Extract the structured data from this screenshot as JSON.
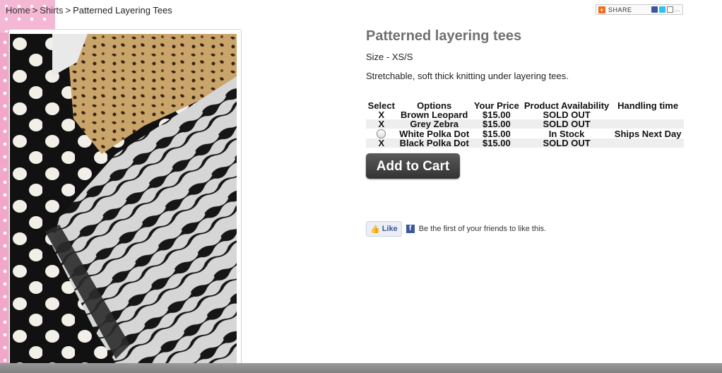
{
  "breadcrumb": {
    "home": "Home",
    "sep1": ">",
    "category": "Shirts",
    "sep2": ">",
    "current": "Patterned Layering Tees"
  },
  "share": {
    "label": "SHARE",
    "more": "…"
  },
  "product": {
    "title": "Patterned layering tees",
    "size": "Size - XS/S",
    "description": "Stretchable, soft thick knitting under layering tees."
  },
  "options_table": {
    "headers": [
      "Select",
      "Options",
      "Your Price",
      "Product Availability",
      "Handling time"
    ],
    "rows": [
      {
        "select": "X",
        "option": "Brown Leopard",
        "price": "$15.00",
        "availability": "SOLD OUT",
        "handling": ""
      },
      {
        "select": "X",
        "option": "Grey Zebra",
        "price": "$15.00",
        "availability": "SOLD OUT",
        "handling": ""
      },
      {
        "select": "radio",
        "option": "White Polka Dot",
        "price": "$15.00",
        "availability": "In Stock",
        "handling": "Ships Next Day"
      },
      {
        "select": "X",
        "option": "Black Polka Dot",
        "price": "$15.00",
        "availability": "SOLD OUT",
        "handling": ""
      }
    ]
  },
  "cart": {
    "label": "Add to Cart"
  },
  "facebook": {
    "like_label": "Like",
    "text": "Be the first of your friends to like this.",
    "icon_letter": "f"
  },
  "colors": {
    "title": "#707070",
    "button": "#444444",
    "fb_blue": "#3b5998",
    "pink_border": "#f2a6c8"
  }
}
